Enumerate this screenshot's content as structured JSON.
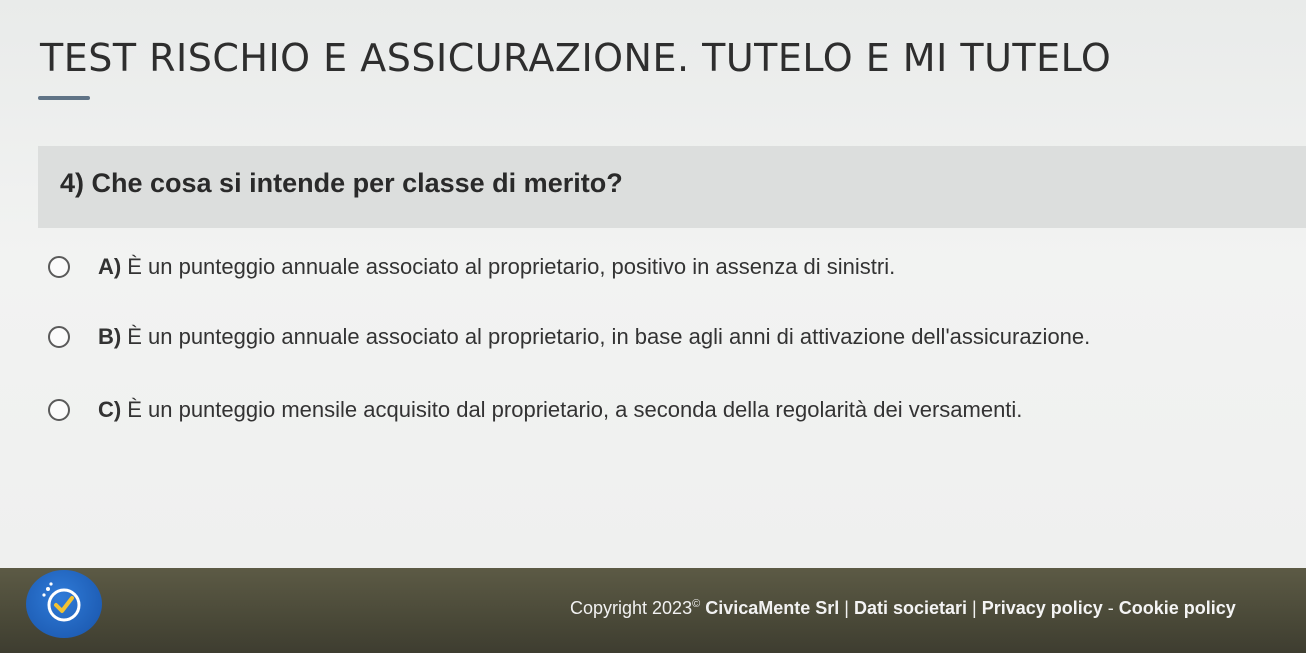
{
  "page": {
    "title": "TEST RISCHIO E ASSICURAZIONE. TUTELO E MI TUTELO"
  },
  "question": {
    "text": "4) Che cosa si intende per classe di merito?"
  },
  "options": [
    {
      "letter": "A)",
      "text": "È un punteggio annuale associato al proprietario, positivo in assenza di sinistri."
    },
    {
      "letter": "B)",
      "text": "È un punteggio annuale associato al proprietario, in base agli anni di attivazione dell'assicurazione."
    },
    {
      "letter": "C)",
      "text": "È un punteggio mensile acquisito dal proprietario, a seconda della regolarità dei versamenti."
    }
  ],
  "footer": {
    "copyright_prefix": "Copyright 2023",
    "copyright_mark": "©",
    "company": "CivicaMente Srl",
    "separator_1": " | ",
    "link_dati": "Dati societari",
    "separator_2": " | ",
    "link_privacy": "Privacy policy",
    "separator_3": " - ",
    "link_cookie": "Cookie policy"
  },
  "colors": {
    "footer_bg": "#4a4938",
    "logo_blue": "#1f5fb7",
    "title_underline": "#5f7386",
    "question_band": "#dcdedd"
  },
  "icons": {
    "logo": "civicamente-logo-icon",
    "radio": "radio-unchecked-icon"
  }
}
